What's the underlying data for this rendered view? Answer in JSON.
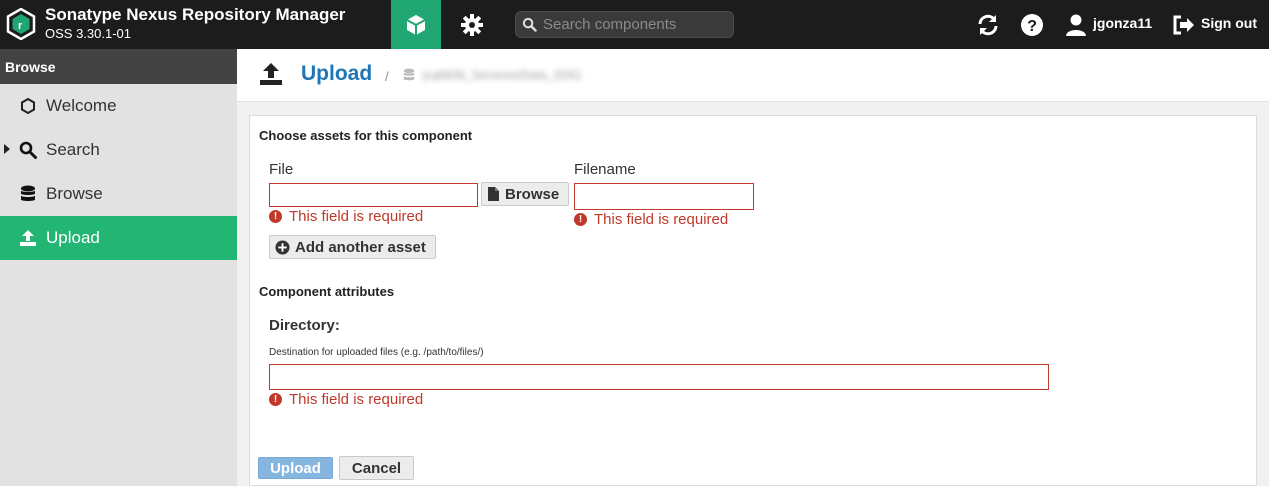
{
  "topbar": {
    "title": "Sonatype Nexus Repository Manager",
    "version": "OSS 3.30.1-01",
    "search_placeholder": "Search components",
    "user": "jgonza11",
    "signout": "Sign out"
  },
  "sidebar": {
    "header": "Browse",
    "items": [
      {
        "label": "Welcome",
        "icon": "hexagon-icon"
      },
      {
        "label": "Search",
        "icon": "search-icon"
      },
      {
        "label": "Browse",
        "icon": "database-icon"
      },
      {
        "label": "Upload",
        "icon": "upload-icon",
        "active": true
      }
    ]
  },
  "page": {
    "title": "Upload",
    "separator": "/",
    "repo_name": "jcq6836_Services/Data_2D61"
  },
  "form": {
    "assets_section": "Choose assets for this component",
    "file_label": "File",
    "browse_label": "Browse",
    "filename_label": "Filename",
    "required_error": "This field is required",
    "add_asset_label": "Add another asset",
    "attributes_section": "Component attributes",
    "directory_label": "Directory:",
    "directory_help": "Destination for uploaded files (e.g. /path/to/files/)",
    "upload_label": "Upload",
    "cancel_label": "Cancel"
  },
  "colors": {
    "accent_green": "#22b573",
    "error_red": "#c0392b",
    "link_blue": "#1d76b8",
    "topbar": "#1c1c1c"
  }
}
